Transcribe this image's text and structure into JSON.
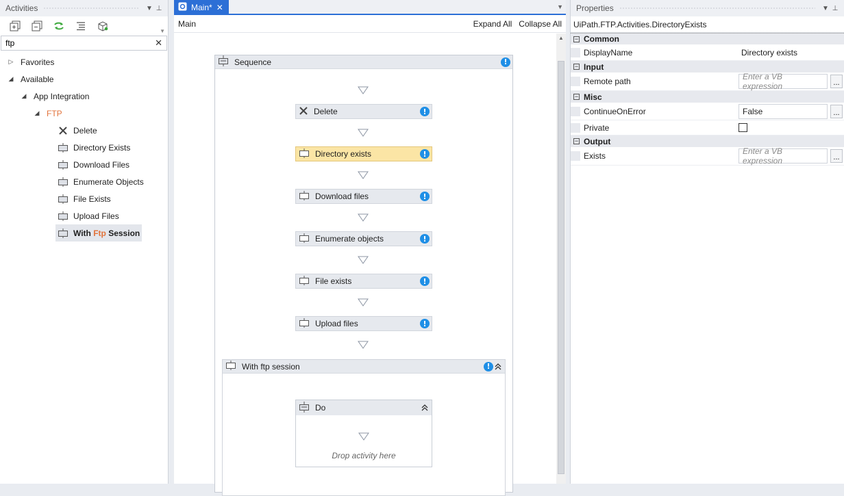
{
  "activities": {
    "title": "Activities",
    "search_value": "ftp",
    "tree": {
      "favorites": "Favorites",
      "available": "Available",
      "app_integration": "App Integration",
      "ftp": "FTP"
    },
    "items": [
      {
        "label": "Delete",
        "icon": "x-icon"
      },
      {
        "label": "Directory Exists",
        "icon": "activity-icon"
      },
      {
        "label": "Download Files",
        "icon": "activity-icon"
      },
      {
        "label": "Enumerate Objects",
        "icon": "activity-icon"
      },
      {
        "label": "File Exists",
        "icon": "activity-icon"
      },
      {
        "label": "Upload Files",
        "icon": "activity-icon"
      }
    ],
    "selected_item": {
      "prefix": "With ",
      "highlight": "Ftp",
      "suffix": " Session"
    }
  },
  "designer": {
    "tab_label": "Main*",
    "breadcrumb": "Main",
    "expand_all": "Expand All",
    "collapse_all": "Collapse All",
    "sequence_title": "Sequence",
    "activities": [
      {
        "title": "Delete",
        "icon": "x-icon",
        "selected": false
      },
      {
        "title": "Directory exists",
        "icon": "activity-icon",
        "selected": true
      },
      {
        "title": "Download files",
        "icon": "activity-icon",
        "selected": false
      },
      {
        "title": "Enumerate objects",
        "icon": "activity-icon",
        "selected": false
      },
      {
        "title": "File exists",
        "icon": "activity-icon",
        "selected": false
      },
      {
        "title": "Upload files",
        "icon": "activity-icon",
        "selected": false
      }
    ],
    "with_session_title": "With ftp session",
    "do_title": "Do",
    "drop_hint": "Drop activity here"
  },
  "properties": {
    "title": "Properties",
    "type_name": "UiPath.FTP.Activities.DirectoryExists",
    "categories": {
      "common": "Common",
      "input": "Input",
      "misc": "Misc",
      "output": "Output"
    },
    "display_name_label": "DisplayName",
    "display_name_value": "Directory exists",
    "remote_path_label": "Remote path",
    "vb_placeholder": "Enter a VB expression",
    "continue_label": "ContinueOnError",
    "continue_value": "False",
    "private_label": "Private",
    "exists_label": "Exists",
    "ellipsis": "..."
  },
  "colors": {
    "accent": "#2c6fd6",
    "highlight": "#e2733b",
    "warning": "#1f8fe6",
    "selected_activity": "#fbe5a5"
  }
}
